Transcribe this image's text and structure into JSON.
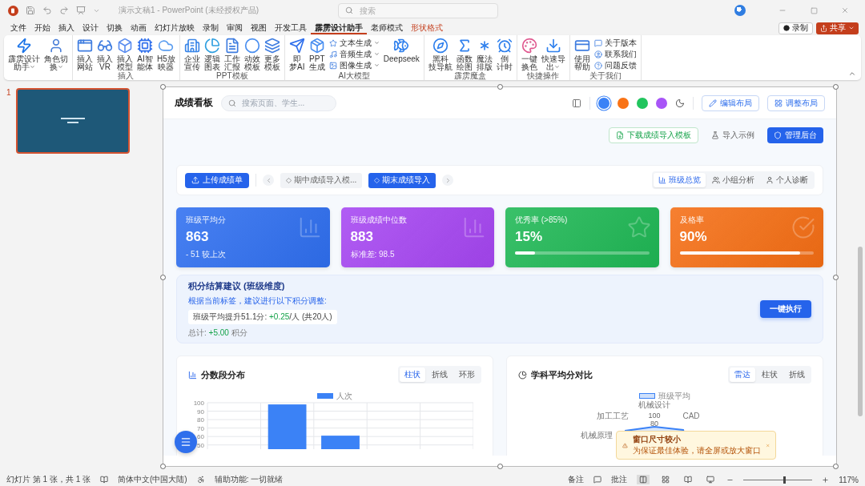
{
  "window": {
    "title": "演示文稿1  -  PowerPoint (未经授权产品)",
    "search_placeholder": "搜索"
  },
  "menu_tabs": [
    {
      "label": "文件",
      "selected": false,
      "kind": "normal"
    },
    {
      "label": "开始",
      "selected": false,
      "kind": "normal"
    },
    {
      "label": "插入",
      "selected": false,
      "kind": "normal"
    },
    {
      "label": "设计",
      "selected": false,
      "kind": "normal"
    },
    {
      "label": "切换",
      "selected": false,
      "kind": "normal"
    },
    {
      "label": "动画",
      "selected": false,
      "kind": "normal"
    },
    {
      "label": "幻灯片放映",
      "selected": false,
      "kind": "normal"
    },
    {
      "label": "录制",
      "selected": false,
      "kind": "normal"
    },
    {
      "label": "审阅",
      "selected": false,
      "kind": "normal"
    },
    {
      "label": "视图",
      "selected": false,
      "kind": "normal"
    },
    {
      "label": "开发工具",
      "selected": false,
      "kind": "normal"
    },
    {
      "label": "霹雳设计助手",
      "selected": true,
      "kind": "normal"
    },
    {
      "label": "老师模式",
      "selected": false,
      "kind": "normal"
    },
    {
      "label": "形状格式",
      "selected": false,
      "kind": "contextual"
    }
  ],
  "record_button": "录制",
  "share_button": "共享",
  "ribbon_groups": [
    {
      "items": [
        {
          "kind": "large",
          "lines": [
            "霹雳设计",
            "助手"
          ],
          "dropdown": true
        },
        {
          "kind": "large",
          "lines": [
            "角色切",
            "换"
          ],
          "dropdown": true
        }
      ]
    },
    {
      "label": "插入",
      "items": [
        {
          "kind": "large",
          "lines": [
            "插入",
            "网站"
          ],
          "dropdown": false
        },
        {
          "kind": "large",
          "lines": [
            "插入",
            "VR"
          ],
          "dropdown": false
        },
        {
          "kind": "large",
          "lines": [
            "插入",
            "模型"
          ],
          "dropdown": false
        },
        {
          "kind": "large",
          "lines": [
            "AI智",
            "能体"
          ],
          "dropdown": false
        },
        {
          "kind": "large",
          "lines": [
            "H5放",
            "映器"
          ],
          "dropdown": false
        }
      ]
    },
    {
      "label": "PPT模板",
      "items": [
        {
          "kind": "large",
          "lines": [
            "企业",
            "宣传"
          ],
          "dropdown": false
        },
        {
          "kind": "large",
          "lines": [
            "逻辑",
            "图表"
          ],
          "dropdown": false
        },
        {
          "kind": "large",
          "lines": [
            "工作",
            "汇报"
          ],
          "dropdown": false
        },
        {
          "kind": "large",
          "lines": [
            "动效",
            "模板"
          ],
          "dropdown": false
        },
        {
          "kind": "large",
          "lines": [
            "更多",
            "模板"
          ],
          "dropdown": false
        }
      ]
    },
    {
      "label": "AI大模型",
      "items": [
        {
          "kind": "large",
          "lines": [
            "即",
            "梦AI"
          ],
          "dropdown": false
        },
        {
          "kind": "large",
          "lines": [
            "PPT",
            "生成"
          ],
          "dropdown": false
        },
        {
          "kind": "stack",
          "entries": [
            {
              "label": "文本生成",
              "dropdown": true
            },
            {
              "label": "音频生成",
              "dropdown": true
            },
            {
              "label": "图像生成",
              "dropdown": true
            }
          ]
        },
        {
          "kind": "large",
          "lines": [
            "Deepseek"
          ],
          "dropdown": false
        }
      ]
    },
    {
      "label": "霹雳魔盒",
      "items": [
        {
          "kind": "large",
          "lines": [
            "黑科",
            "技导航"
          ],
          "dropdown": false
        },
        {
          "kind": "large",
          "lines": [
            "函数",
            "绘图"
          ],
          "dropdown": false
        },
        {
          "kind": "large",
          "lines": [
            "魔法",
            "排版"
          ],
          "dropdown": false
        },
        {
          "kind": "large",
          "lines": [
            "倒",
            "计时"
          ],
          "dropdown": false
        }
      ]
    },
    {
      "label": "快捷操作",
      "items": [
        {
          "kind": "large",
          "lines": [
            "一键",
            "换色"
          ],
          "dropdown": false
        },
        {
          "kind": "large",
          "lines": [
            "快速导",
            "出"
          ],
          "dropdown": true
        }
      ]
    },
    {
      "label": "关于我们",
      "items": [
        {
          "kind": "large",
          "lines": [
            "使用",
            "帮助"
          ],
          "dropdown": false
        },
        {
          "kind": "stack",
          "entries": [
            {
              "label": "关于版本",
              "dropdown": false
            },
            {
              "label": "联系我们",
              "dropdown": false
            },
            {
              "label": "问题反馈",
              "dropdown": false
            }
          ]
        }
      ]
    }
  ],
  "slide_thumbnail": {
    "number": "1",
    "selected": true
  },
  "dashboard": {
    "title": "成绩看板",
    "search_placeholder": "搜索页面、学生...",
    "theme_colors": [
      {
        "color": "#3b82f6",
        "selected": true
      },
      {
        "color": "#f97316",
        "selected": false
      },
      {
        "color": "#22c55e",
        "selected": false
      },
      {
        "color": "#a855f7",
        "selected": false
      }
    ],
    "header_buttons": [
      "编辑布局",
      "调整布局"
    ],
    "actions": [
      {
        "label": "下载成绩导入模板",
        "kind": "outline"
      },
      {
        "label": "导入示例",
        "kind": "ghost"
      },
      {
        "label": "管理后台",
        "kind": "primary"
      }
    ],
    "upload_button": "上传成绩单",
    "imports": [
      {
        "label": "期中成绩导入模...",
        "selected": false
      },
      {
        "label": "期末成绩导入",
        "selected": true
      }
    ],
    "view_tabs": [
      {
        "label": "班级总览",
        "selected": true
      },
      {
        "label": "小组分析",
        "selected": false
      },
      {
        "label": "个人诊断",
        "selected": false
      }
    ],
    "stat_cards": [
      {
        "kind": "note",
        "title": "班级平均分",
        "value": "863",
        "note": "- 51 较上次",
        "color": "#2f6ff0"
      },
      {
        "kind": "note",
        "title": "班级成绩中位数",
        "value": "883",
        "note": "标准差: 98.5",
        "color": "#a646f2"
      },
      {
        "kind": "progress",
        "title": "优秀率 (>85%)",
        "value": "15%",
        "level": 0.15,
        "color": "#1fb855"
      },
      {
        "kind": "progress",
        "title": "及格率",
        "value": "90%",
        "level": 0.9,
        "color": "#f56e14"
      }
    ],
    "suggestion": {
      "title": "积分结算建议 (班级维度)",
      "subtitle": "根据当前标签，建议进行以下积分调整:",
      "item_prefix": "班级平均提升51.1分:",
      "item_delta": "+0.25",
      "item_suffix": "/人 (共20人)",
      "total_label": "总计:",
      "total_value": "+5.00",
      "total_unit": "积分",
      "button": "一键执行"
    },
    "distribution": {
      "title": "分数段分布",
      "tabs": [
        {
          "label": "柱状",
          "selected": true
        },
        {
          "label": "折线",
          "selected": false
        },
        {
          "label": "环形",
          "selected": false
        }
      ],
      "chart_data": {
        "type": "bar",
        "series": [
          {
            "name": "人次",
            "color": "#3b82f6",
            "values": [
              null,
              98,
              61,
              null,
              null
            ]
          }
        ],
        "ylim": [
          45,
          100
        ],
        "yticks": [
          50,
          60,
          70,
          80,
          90,
          100
        ],
        "grid": true
      }
    },
    "radar": {
      "title": "学科平均分对比",
      "tabs": [
        {
          "label": "雷达",
          "selected": true
        },
        {
          "label": "柱状",
          "selected": false
        },
        {
          "label": "折线",
          "selected": false
        }
      ],
      "legend": "班级平均",
      "axes": [
        "机械设计",
        "CAD",
        "加工工艺",
        "机械原理"
      ],
      "ticks": [
        "100",
        "80"
      ]
    },
    "toast": {
      "title": "窗口尺寸较小",
      "message": "为保证最佳体验，请全屏或放大窗口"
    }
  },
  "status_bar": {
    "slide_info": "幻灯片 第 1 张，共 1 张",
    "language": "简体中文(中国大陆)",
    "accessibility": "辅助功能: 一切就绪",
    "notes": "备注",
    "comments": "批注",
    "views": [
      {
        "selected": true
      },
      {
        "selected": false
      },
      {
        "selected": false
      },
      {
        "selected": false
      }
    ],
    "zoom_slider": {
      "level": 0.58
    },
    "zoom": "117%"
  }
}
